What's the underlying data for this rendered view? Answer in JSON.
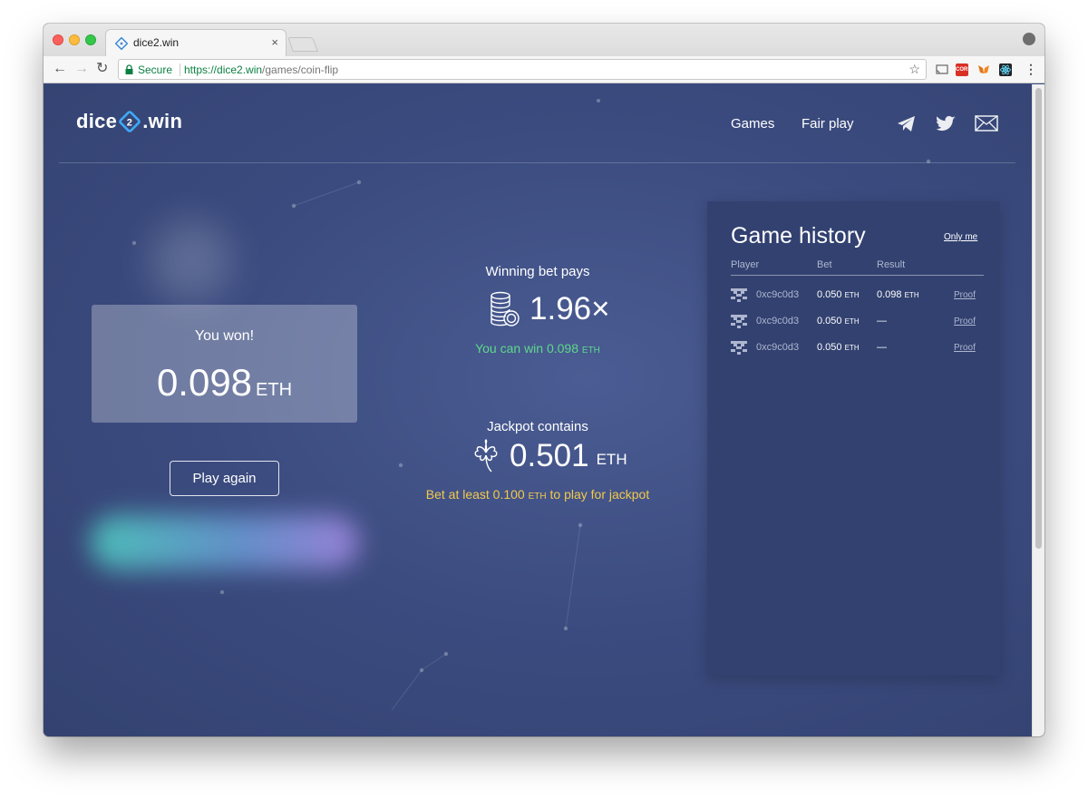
{
  "browser": {
    "tab_title": "dice2.win",
    "tab_close": "×",
    "secure_label": "Secure",
    "url_domain": "https://dice2.win",
    "url_path": "/games/coin-flip",
    "ext_label": "CORS"
  },
  "header": {
    "logo_left": "dice",
    "logo_right": ".win",
    "nav": [
      "Games",
      "Fair play"
    ],
    "social_icons": [
      "telegram-icon",
      "twitter-icon",
      "mail-icon"
    ]
  },
  "result": {
    "title": "You won!",
    "amount": "0.098",
    "unit": "ETH",
    "play_again": "Play again"
  },
  "payout": {
    "label": "Winning bet pays",
    "multiplier": "1.96×",
    "win_prefix": "You can win 0.098",
    "win_unit": "ETH"
  },
  "jackpot": {
    "label": "Jackpot contains",
    "amount": "0.501",
    "unit": "ETH",
    "note_prefix": "Bet at least 0.100",
    "note_unit": "ETH",
    "note_suffix": "to play for jackpot"
  },
  "history": {
    "title": "Game history",
    "only_me": "Only me",
    "columns": [
      "Player",
      "Bet",
      "Result"
    ],
    "rows": [
      {
        "player": "0xc9c0d3",
        "bet": "0.050",
        "bet_unit": "ETH",
        "result": "0.098",
        "result_unit": "ETH",
        "proof": "Proof"
      },
      {
        "player": "0xc9c0d3",
        "bet": "0.050",
        "bet_unit": "ETH",
        "result": "—",
        "result_unit": "",
        "proof": "Proof"
      },
      {
        "player": "0xc9c0d3",
        "bet": "0.050",
        "bet_unit": "ETH",
        "result": "—",
        "result_unit": "",
        "proof": "Proof"
      }
    ]
  },
  "colors": {
    "page_bg": "#3b4b7f",
    "panel_bg": "#324170",
    "win_green": "#5fd88b",
    "jackpot_yellow": "#f2c94c"
  }
}
